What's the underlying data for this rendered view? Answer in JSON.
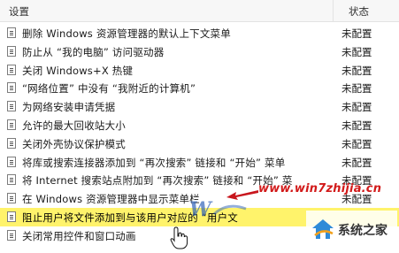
{
  "header": {
    "setting_label": "设置",
    "state_label": "状态"
  },
  "rows": [
    {
      "label": "删除 Windows 资源管理器的默认上下文菜单",
      "state": "未配置"
    },
    {
      "label": "防止从 “我的电脑” 访问驱动器",
      "state": "未配置"
    },
    {
      "label": "关闭 Windows+X 热键",
      "state": "未配置"
    },
    {
      "label": "“网络位置” 中没有 “我附近的计算机”",
      "state": "未配置"
    },
    {
      "label": "为网络安装申请凭据",
      "state": "未配置"
    },
    {
      "label": "允许的最大回收站大小",
      "state": "未配置"
    },
    {
      "label": "关闭外壳协议保护模式",
      "state": "未配置"
    },
    {
      "label": "将库或搜索连接器添加到 “再次搜索” 链接和 “开始” 菜单",
      "state": "未配置"
    },
    {
      "label": "将 Internet 搜索站点附加到 “再次搜索” 链接和 “开始” 菜",
      "state": "未配置"
    },
    {
      "label": "在 Windows 资源管理器中显示菜单栏",
      "state": "未配置"
    },
    {
      "label": "阻止用户将文件添加到与该用户对应的 “用户文",
      "state": "",
      "selected": true
    },
    {
      "label": "关闭常用控件和窗口动画",
      "state": ""
    }
  ],
  "watermark": {
    "url": "www.win7zhijia.cn",
    "brand": "系统之家"
  },
  "colors": {
    "selected_row": "#fff36b",
    "watermark_red": "#d21a1a"
  }
}
